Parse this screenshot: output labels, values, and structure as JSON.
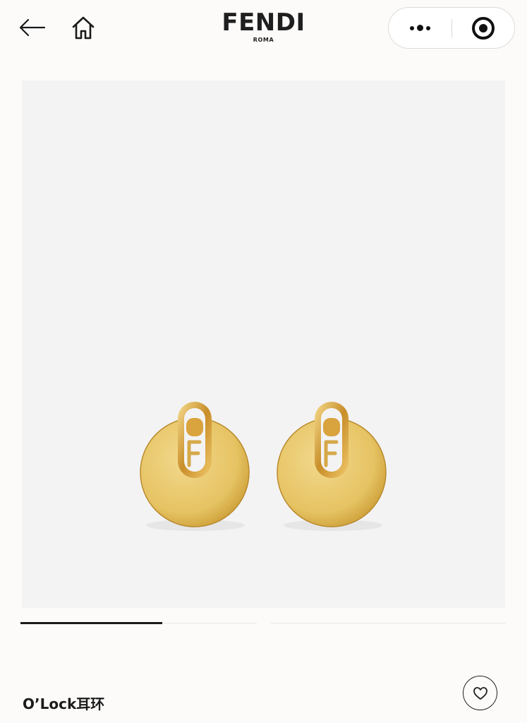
{
  "header": {
    "brand_name": "FENDI",
    "brand_sub": "ROMA",
    "back_icon": "arrow-left-icon",
    "home_icon": "home-icon",
    "more_icon": "more-dots-icon",
    "close_icon": "target-circle-icon"
  },
  "product": {
    "title": "O’Lock耳环",
    "image_background": "#f3f3f4",
    "metal_color": "#e7c66a"
  },
  "carousel": {
    "page_count": 2,
    "active_index": 0
  },
  "actions": {
    "favorite_icon": "heart-icon"
  }
}
